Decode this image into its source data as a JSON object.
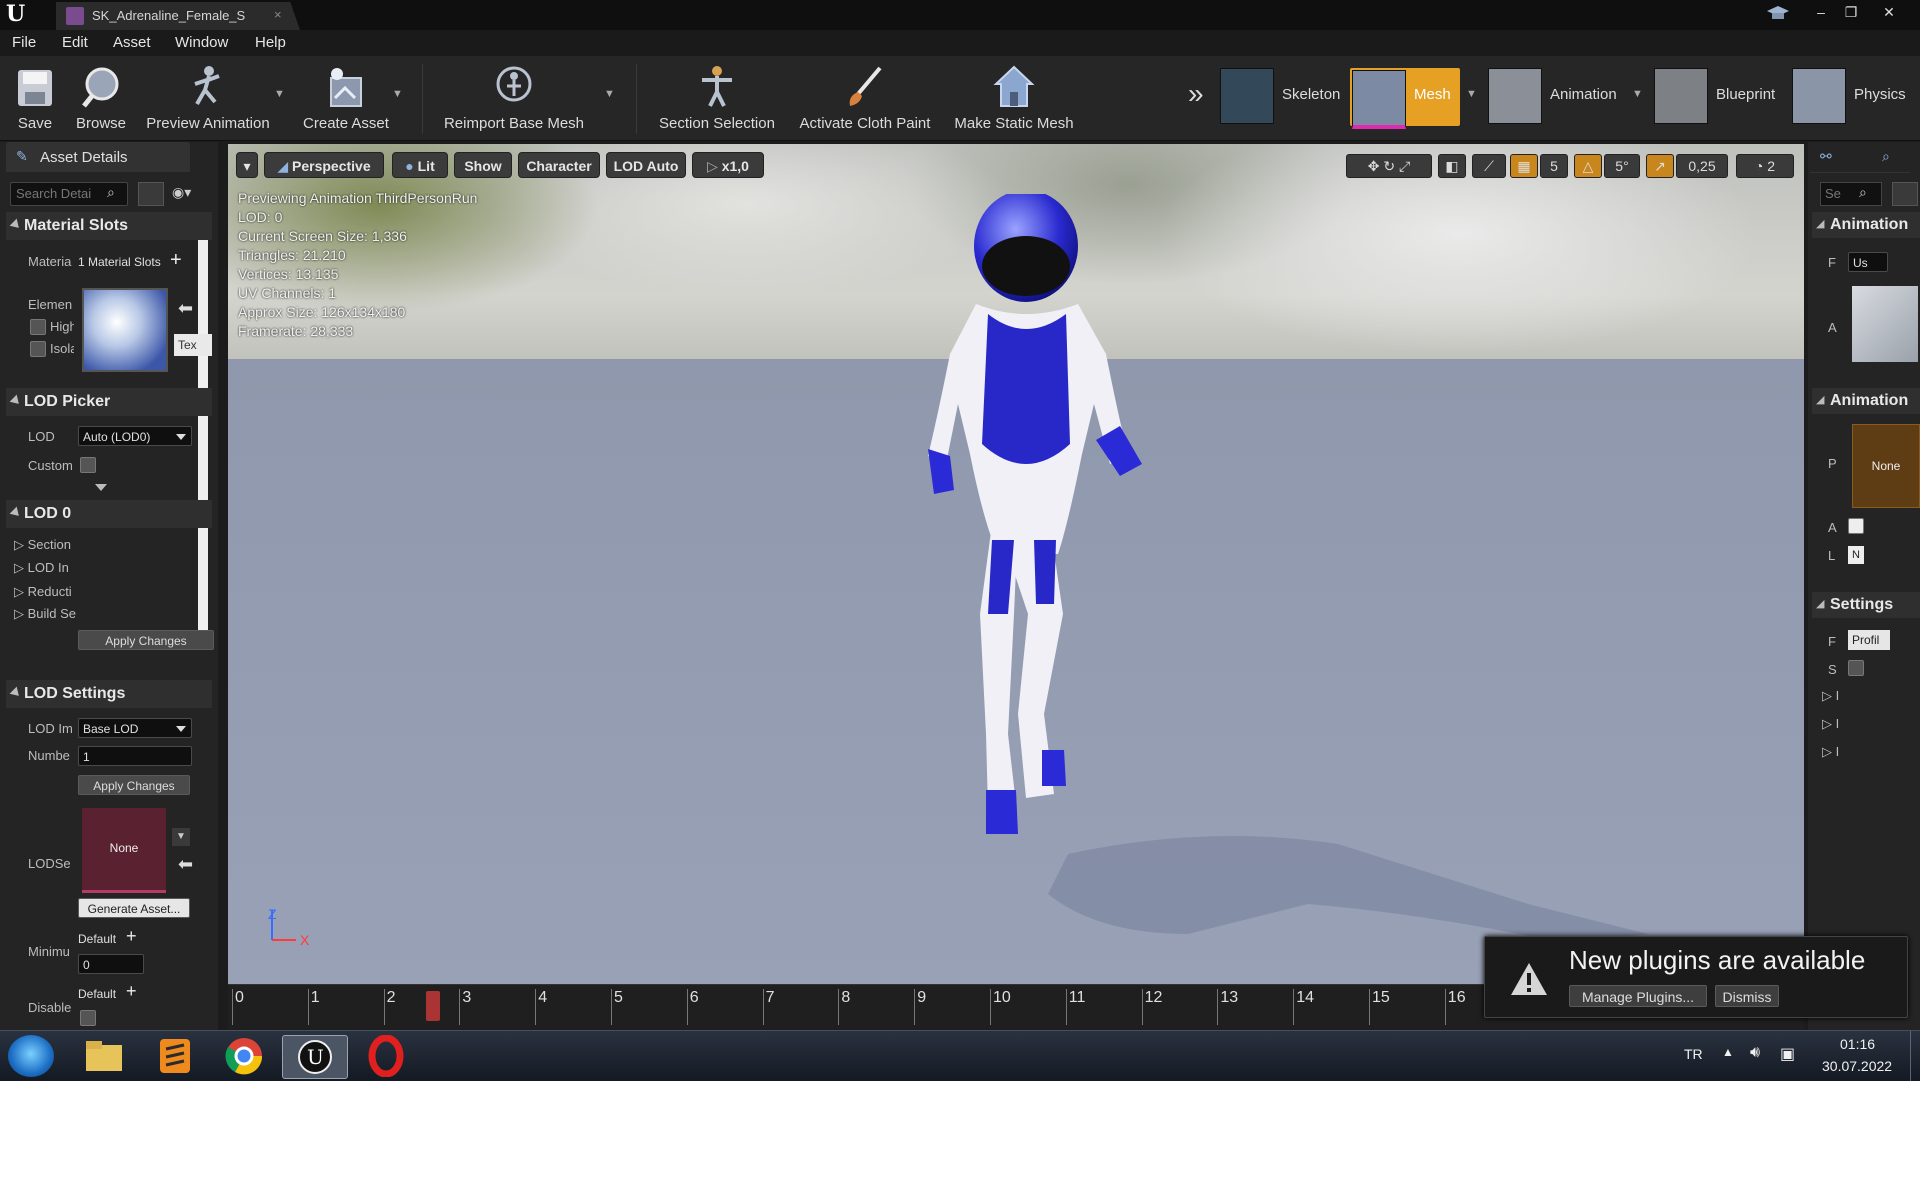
{
  "window": {
    "tab_title": "SK_Adrenaline_Female_S",
    "tab_close": "×",
    "min": "–",
    "max": "❐",
    "close": "✕"
  },
  "menu": [
    "File",
    "Edit",
    "Asset",
    "Window",
    "Help"
  ],
  "toolbar": {
    "save": "Save",
    "browse": "Browse",
    "preview_animation": "Preview Animation",
    "create_asset": "Create Asset",
    "reimport": "Reimport Base Mesh",
    "section_selection": "Section Selection",
    "activate_cloth": "Activate Cloth Paint",
    "make_static": "Make Static Mesh",
    "more": "»",
    "modes": {
      "skeleton": "Skeleton",
      "mesh": "Mesh",
      "animation": "Animation",
      "blueprint": "Blueprint",
      "physics": "Physics"
    }
  },
  "left_panel": {
    "tab": "Asset Details",
    "search_placeholder": "Search Detai",
    "material_slots": {
      "header": "Material Slots",
      "row_label": "Materia",
      "count": "1 Material Slots",
      "element_label": "Elemen",
      "high_label": "High",
      "isol_label": "Isola",
      "tex_btn": "Tex"
    },
    "lod_picker": {
      "header": "LOD Picker",
      "lod_label": "LOD",
      "lod_value": "Auto (LOD0)",
      "custom_label": "Custom"
    },
    "lod0": {
      "header": "LOD 0",
      "items": [
        "Section",
        "LOD In",
        "Reducti",
        "Build Se"
      ],
      "apply": "Apply Changes"
    },
    "lod_settings": {
      "header": "LOD Settings",
      "import_label": "LOD Im",
      "import_value": "Base LOD",
      "number_label": "Numbe",
      "number_value": "1",
      "apply": "Apply Changes",
      "lodset_label": "LODSe",
      "lodset_value": "None",
      "generate": "Generate Asset...",
      "minimum_label": "Minimu",
      "minimum_default": "Default",
      "minimum_value": "0",
      "disable_label": "Disable",
      "disable_default": "Default"
    }
  },
  "viewport": {
    "buttons": {
      "perspective": "Perspective",
      "lit": "Lit",
      "show": "Show",
      "character": "Character",
      "lod": "LOD Auto",
      "speed": "x1,0"
    },
    "info": [
      "Previewing Animation ThirdPersonRun",
      "LOD: 0",
      "Current Screen Size: 1,336",
      "Triangles: 21.210",
      "Vertices: 13.135",
      "UV Channels: 1",
      "Approx Size: 126x134x180",
      "Framerate: 28,333"
    ],
    "tools": {
      "grid_value": "5",
      "rot_value": "5°",
      "scale_value": "0,25",
      "cam_value": "2"
    },
    "axis_z": "Z",
    "axis_x": "X"
  },
  "timeline": {
    "ticks": [
      "0",
      "1",
      "2",
      "3",
      "4",
      "5",
      "6",
      "7",
      "8",
      "9",
      "10",
      "11",
      "12",
      "13",
      "14",
      "15",
      "16"
    ],
    "position": 2.65
  },
  "right_panel": {
    "search_placeholder": "Se",
    "animation1": "Animation",
    "use_value": "Us",
    "f_label": "F",
    "a_label": "A",
    "animation2": "Animation",
    "p_label": "P",
    "none_value": "None",
    "a2_label": "A",
    "l_label": "L",
    "n_value": "N",
    "settings": "Settings",
    "r_label": "F",
    "profile_value": "Profil",
    "s_label": "S",
    "tree": [
      "I",
      "I",
      "I"
    ]
  },
  "notification": {
    "title": "New plugins are available",
    "manage": "Manage Plugins...",
    "dismiss": "Dismiss"
  },
  "taskbar": {
    "lang": "TR",
    "time": "01:16",
    "date": "30.07.2022"
  }
}
